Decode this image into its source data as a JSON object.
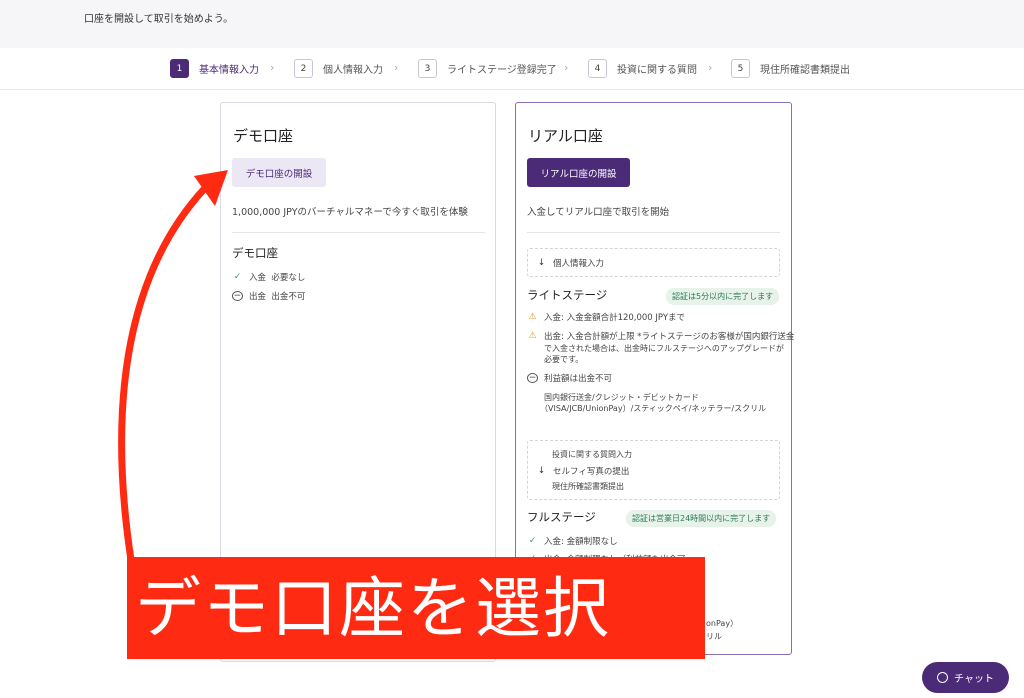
{
  "intro_text": "口座を開設して取引を始めよう。",
  "steps": [
    {
      "num": "1",
      "label": "基本情報入力"
    },
    {
      "num": "2",
      "label": "個人情報入力"
    },
    {
      "num": "3",
      "label": "ライトステージ登録完了"
    },
    {
      "num": "4",
      "label": "投資に関する質問"
    },
    {
      "num": "5",
      "label": "現住所確認書類提出"
    }
  ],
  "demo": {
    "title": "デモ口座",
    "button": "デモ口座の開設",
    "desc": "1,000,000 JPYのバーチャルマネーで今すぐ取引を体験",
    "section_title": "デモ口座",
    "features": [
      {
        "label": "入金",
        "value": "必要なし"
      },
      {
        "label": "出金",
        "value": "出金不可"
      }
    ]
  },
  "real": {
    "title": "リアル口座",
    "button": "リアル口座の開設",
    "desc": "入金してリアル口座で取引を開始",
    "personal_info": "個人情報入力",
    "lite": {
      "title": "ライトステージ",
      "badge": "認証は5分以内に完了します",
      "deposit": "入金: 入金金額合計120,000 JPYまで",
      "withdraw_line1": "出金: 入金合計額が上限 *ライトステージのお客様が国内銀行送金",
      "withdraw_line2": "で入金された場合は、出金時にフルステージへのアップグレードが",
      "withdraw_line3": "必要です。",
      "profit": "利益額は出金不可",
      "methods_line1": "国内銀行送金/クレジット・デビットカード",
      "methods_line2": "（VISA/JCB/UnionPay）/スティックペイ/ネッテラー/スクリル"
    },
    "steps_box": {
      "line1": "投資に関する質問入力",
      "line2": "セルフィ写真の提出",
      "line3": "現住所確認書類提出"
    },
    "full": {
      "title": "フルステージ",
      "badge": "認証は営業日24時間以内に完了します",
      "deposit": "入金: 金額制限なし",
      "partial_1": "出金: 金額制限なし（利益額も出金可",
      "partial_2": "onPay）",
      "partial_3": "リル"
    }
  },
  "overlay_caption": "デモ口座を選択",
  "chat_label": "チャット",
  "colors": {
    "brand": "#4b2a78",
    "annotation": "#ff2a12",
    "badge_bg": "#e6f2ea"
  }
}
